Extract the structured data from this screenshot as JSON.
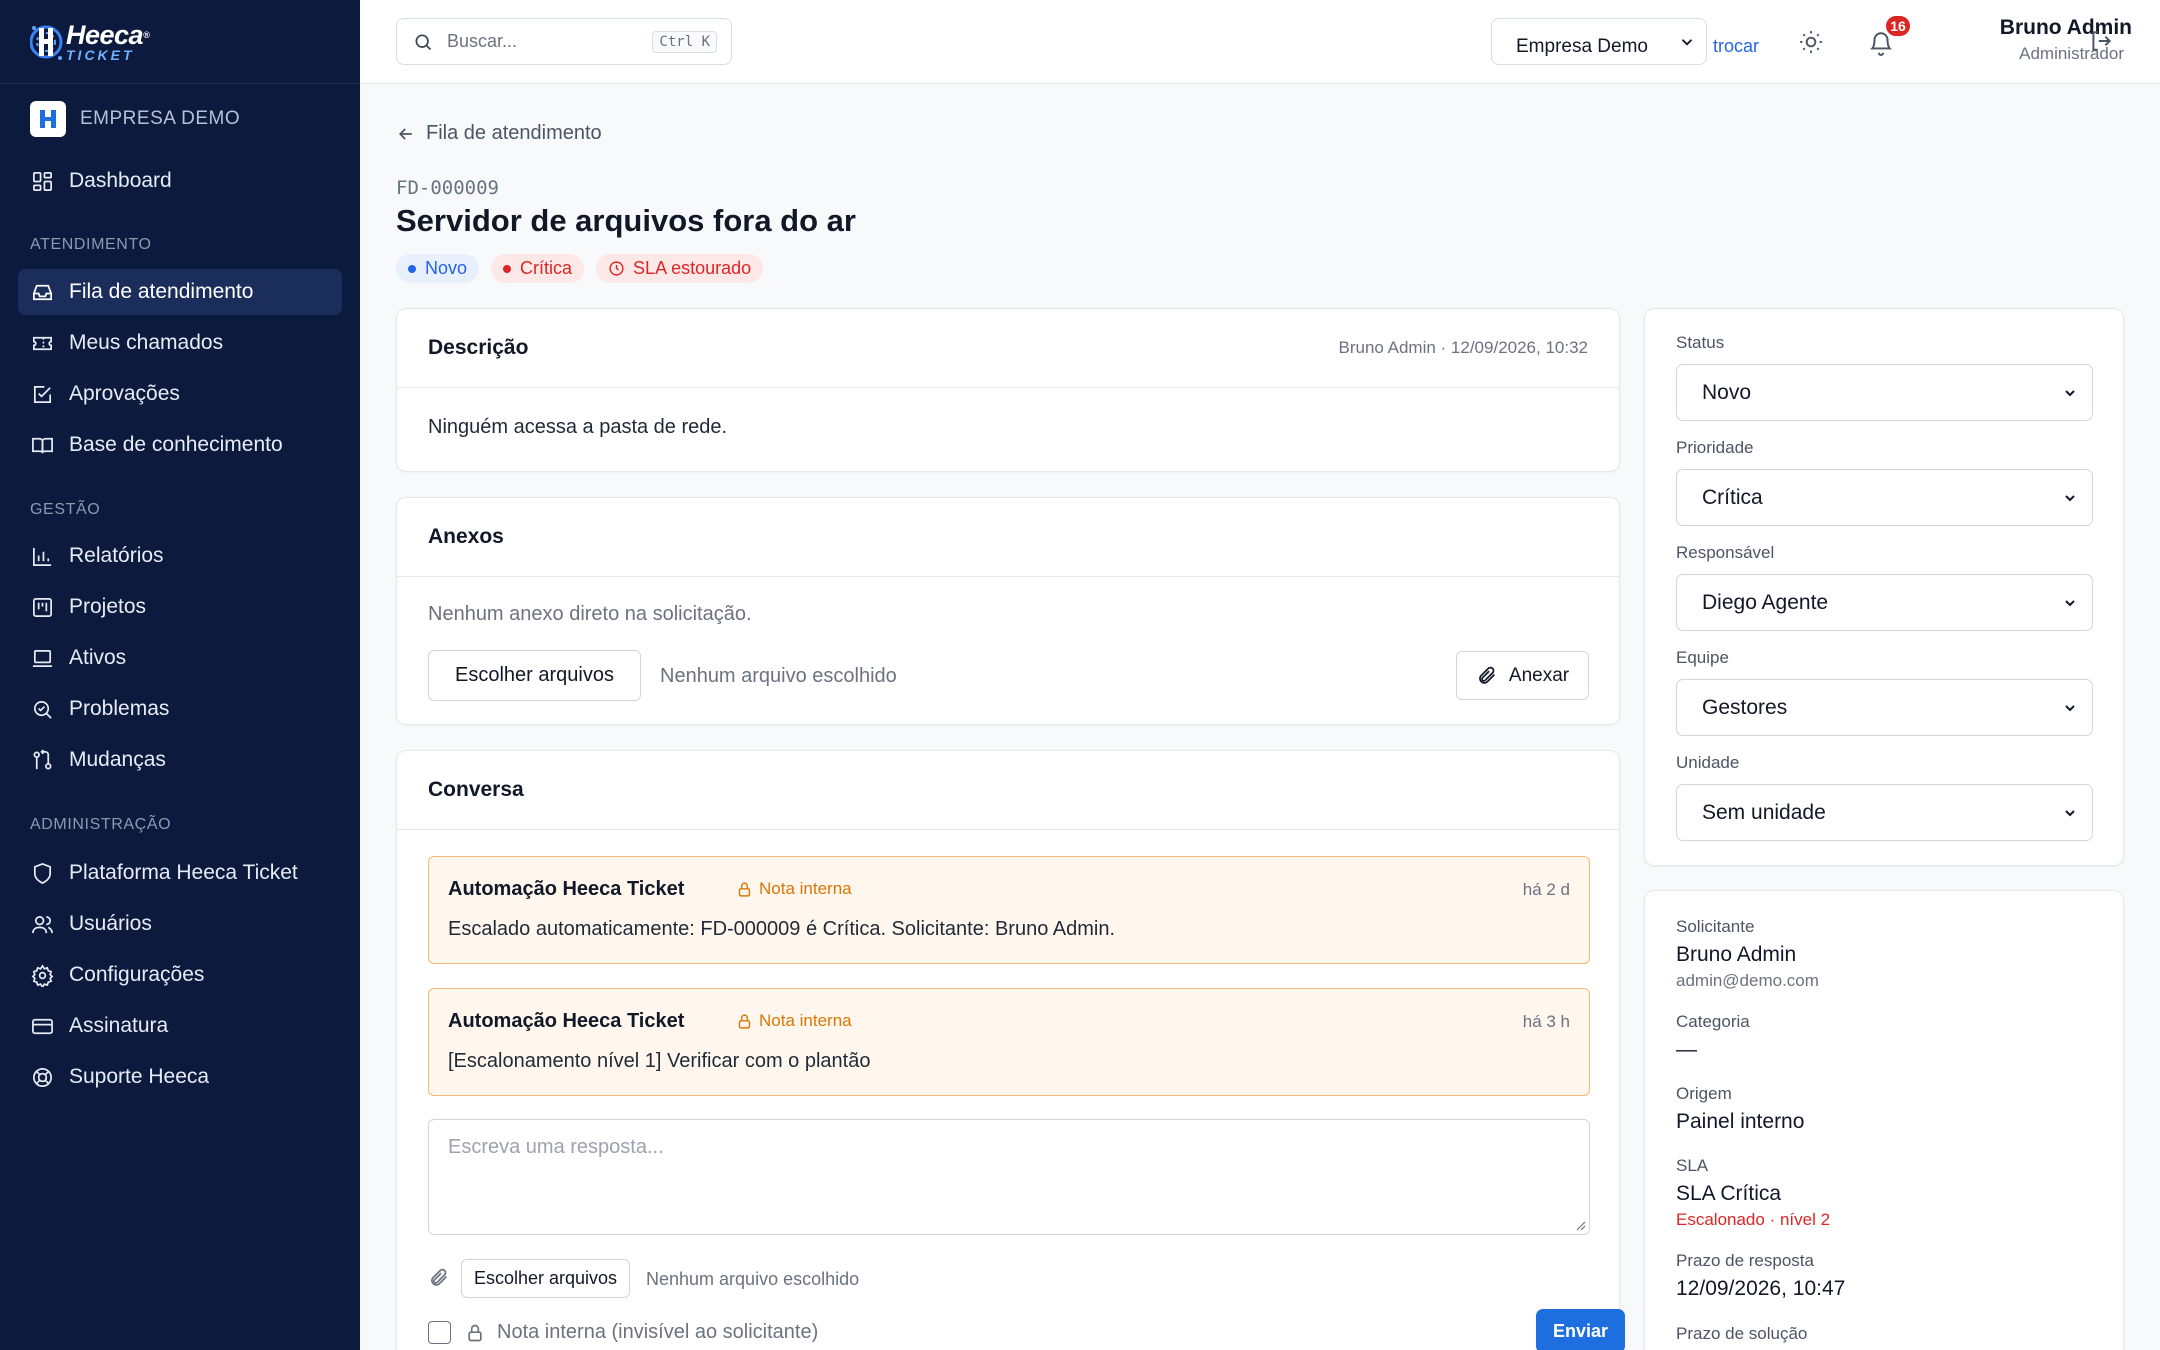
{
  "brand": {
    "word1": "Heeca",
    "word2": "TICKET",
    "tm": "®"
  },
  "sidebar": {
    "company": "EMPRESA DEMO",
    "dashboard": "Dashboard",
    "sections": {
      "atendimento": "ATENDIMENTO",
      "gestao": "GESTÃO",
      "admin": "ADMINISTRAÇÃO"
    },
    "items": {
      "fila": "Fila de atendimento",
      "meus": "Meus chamados",
      "aprovacoes": "Aprovações",
      "base": "Base de conhecimento",
      "relatorios": "Relatórios",
      "projetos": "Projetos",
      "ativos": "Ativos",
      "problemas": "Problemas",
      "mudancas": "Mudanças",
      "plataforma": "Plataforma Heeca Ticket",
      "usuarios": "Usuários",
      "configuracoes": "Configurações",
      "assinatura": "Assinatura",
      "suporte": "Suporte Heeca"
    }
  },
  "topbar": {
    "search_placeholder": "Buscar...",
    "search_shortcut": "Ctrl K",
    "company_selected": "Empresa Demo",
    "switch_label": "trocar",
    "notification_count": "16",
    "user_name": "Bruno Admin",
    "user_role": "Administrador"
  },
  "ticket": {
    "back_label": "Fila de atendimento",
    "id": "FD-000009",
    "title": "Servidor de arquivos fora do ar",
    "chips": {
      "status": "Novo",
      "priority": "Crítica",
      "sla": "SLA estourado"
    }
  },
  "description": {
    "heading": "Descrição",
    "meta": "Bruno Admin · 12/09/2026, 10:32",
    "body": "Ninguém acessa a pasta de rede."
  },
  "attachments": {
    "heading": "Anexos",
    "empty": "Nenhum anexo direto na solicitação.",
    "choose_label": "Escolher arquivos",
    "no_file": "Nenhum arquivo escolhido",
    "attach_label": "Anexar"
  },
  "conversation": {
    "heading": "Conversa",
    "messages": [
      {
        "author": "Automação Heeca Ticket",
        "tag": "Nota interna",
        "time": "há 2 d",
        "text": "Escalado automaticamente: FD-000009 é Crítica. Solicitante: Bruno Admin."
      },
      {
        "author": "Automação Heeca Ticket",
        "tag": "Nota interna",
        "time": "há 3 h",
        "text": "[Escalonamento nível 1] Verificar com o plantão"
      }
    ],
    "reply_placeholder": "Escreva uma resposta...",
    "choose_label": "Escolher arquivos",
    "no_file": "Nenhum arquivo escolhido",
    "internal_note_label": "Nota interna (invisível ao solicitante)",
    "send_label": "Enviar"
  },
  "fields": {
    "status": {
      "label": "Status",
      "value": "Novo"
    },
    "priority": {
      "label": "Prioridade",
      "value": "Crítica"
    },
    "assignee": {
      "label": "Responsável",
      "value": "Diego Agente"
    },
    "team": {
      "label": "Equipe",
      "value": "Gestores"
    },
    "unit": {
      "label": "Unidade",
      "value": "Sem unidade"
    }
  },
  "info": {
    "requester_label": "Solicitante",
    "requester_name": "Bruno Admin",
    "requester_email": "admin@demo.com",
    "category_label": "Categoria",
    "category_value": "—",
    "origin_label": "Origem",
    "origin_value": "Painel interno",
    "sla_label": "SLA",
    "sla_value": "SLA Crítica",
    "sla_escalation": "Escalonado · nível 2",
    "response_label": "Prazo de resposta",
    "response_value": "12/09/2026, 10:47",
    "solution_label": "Prazo de solução"
  },
  "colors": {
    "sidebar_bg": "#0c1a3d",
    "accent": "#1d6fe0",
    "danger": "#dc2626",
    "note_bg": "#fff7ed",
    "note_border": "#f5b97a"
  }
}
